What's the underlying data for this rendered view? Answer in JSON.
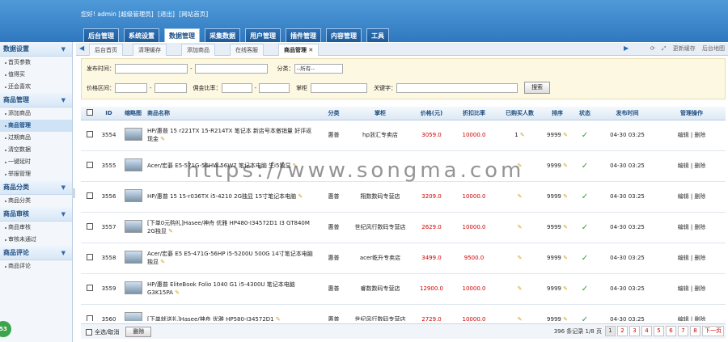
{
  "header": {
    "welcome": "您好! admin [超级管理员]",
    "logout": "[退出]",
    "home": "[网站首页]",
    "nav": [
      "后台管理",
      "系统设置",
      "数据管理",
      "采集数据",
      "用户管理",
      "插件管理",
      "内容管理",
      "工具"
    ],
    "active_nav": "数据管理"
  },
  "sidebar": [
    {
      "title": "数据设置",
      "items": [
        "首页参数",
        "值得买",
        "还会喜欢"
      ]
    },
    {
      "title": "商品管理",
      "items": [
        "添加商品",
        "商品管理",
        "过期商品",
        "清空数据",
        "一键延时",
        "举报管理"
      ]
    },
    {
      "title": "商品分类",
      "items": [
        "商品分类"
      ]
    },
    {
      "title": "商品审核",
      "items": [
        "商品审核",
        "审核未通过"
      ]
    },
    {
      "title": "商品评论",
      "items": [
        "商品评论"
      ]
    }
  ],
  "sidebar_active": "商品管理",
  "badge": "53",
  "tabs": [
    "后台首页",
    "清理缓存",
    "添加商品",
    "在线客服",
    "商品管理 ✕"
  ],
  "tab_tools": [
    "更新缓存",
    "后台地图"
  ],
  "search": {
    "publish_time": "发布时间：",
    "dash": "-",
    "category": "分类：",
    "category_value": "--所有--",
    "price_range": "价格区间：",
    "commission": "佣金比率：",
    "shop": "掌柜",
    "keyword": "关键字：",
    "button": "搜索"
  },
  "table": {
    "headers": [
      "",
      "ID",
      "缩略图",
      "商品名称",
      "分类",
      "掌柜",
      "价格(元)",
      "折扣比率",
      "已购买人数",
      "排序",
      "状态",
      "发布时间",
      "管理操作"
    ],
    "rows": [
      {
        "id": "3554",
        "name": "HP/惠普 15 r221TX 15-R214TX 笔记本 新店号本傲销量 好评返现金",
        "cat": "惠普",
        "shop": "hp浙汇专卖店",
        "price": "3059.0",
        "rate": "10000.0",
        "buyers": "1",
        "sort": "9999",
        "time": "04-30 03:25",
        "edit": "编辑",
        "del": "删除"
      },
      {
        "id": "3555",
        "name": "Acer/宏碁 E5-571G-56HW 56W7 笔记本电脑 生i5独显",
        "cat": "",
        "shop": "",
        "price": "",
        "rate": "",
        "buyers": "",
        "sort": "9999",
        "time": "04-30 03:25",
        "edit": "编辑",
        "del": "删除"
      },
      {
        "id": "3556",
        "name": "HP/惠普 15 15-r036TX i5-4210 2G独显 15寸笔记本电脑",
        "cat": "惠普",
        "shop": "翔数数码专营店",
        "price": "3209.0",
        "rate": "10000.0",
        "buyers": "",
        "sort": "9999",
        "time": "04-30 03:25",
        "edit": "编辑",
        "del": "删除"
      },
      {
        "id": "3557",
        "name": "[下单0元购礼]Hasee/神舟 优雅 HP480-I34572D1 I3 GT840M 2G独显",
        "cat": "惠普",
        "shop": "世纪风行数码专营店",
        "price": "2629.0",
        "rate": "10000.0",
        "buyers": "",
        "sort": "9999",
        "time": "04-30 03:25",
        "edit": "编辑",
        "del": "删除"
      },
      {
        "id": "3558",
        "name": "Acer/宏碁 E5 E5-471G-56HP i5-5200U 500G 14寸笔记本电脑独显",
        "cat": "惠普",
        "shop": "acer乾升专卖店",
        "price": "3499.0",
        "rate": "9500.0",
        "buyers": "",
        "sort": "9999",
        "time": "04-30 03:25",
        "edit": "编辑",
        "del": "删除"
      },
      {
        "id": "3559",
        "name": "HP/惠普 EliteBook Folio 1040 G1 i5-4300U 笔记本电脑 G3K15PA",
        "cat": "惠普",
        "shop": "睿数数码专营店",
        "price": "12900.0",
        "rate": "10000.0",
        "buyers": "",
        "sort": "9999",
        "time": "04-30 03:25",
        "edit": "编辑",
        "del": "删除"
      },
      {
        "id": "3560",
        "name": "[下单就送礼]Hasee/神舟 优雅 HP580-I34572D1",
        "cat": "惠普",
        "shop": "世纪风行数码专营店",
        "price": "2729.0",
        "rate": "10000.0",
        "buyers": "",
        "sort": "9999",
        "time": "04-30 03:25",
        "edit": "编辑",
        "del": "删除"
      }
    ]
  },
  "footer": {
    "select_all": "全选/取消",
    "delete": "删除",
    "records": "396 条记录 1/8 页",
    "pages": [
      "1",
      "2",
      "3",
      "4",
      "5",
      "6",
      "7",
      "8"
    ],
    "next": "下一页"
  },
  "watermark": "https://www.songma.com"
}
